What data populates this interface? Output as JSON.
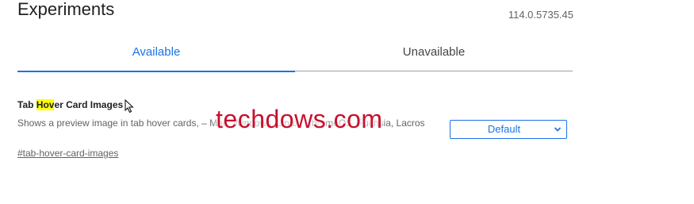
{
  "header": {
    "title": "Experiments",
    "version": "114.0.5735.45"
  },
  "tabs": [
    {
      "label": "Available",
      "active": true
    },
    {
      "label": "Unavailable",
      "active": false
    }
  ],
  "experiment": {
    "name_before": "Tab ",
    "name_highlight": "Hov",
    "name_after": "er Card Images",
    "description": "Shows a preview image in tab hover cards, – Mac, Windows, Linux, ChromeOS, Fuchsia, Lacros",
    "link": "#tab-hover-card-images",
    "select_value": "Default"
  },
  "watermark": "techdows.com",
  "colors": {
    "accent": "#1a73e8",
    "highlight": "#ffff00",
    "watermark": "#c8102e"
  }
}
